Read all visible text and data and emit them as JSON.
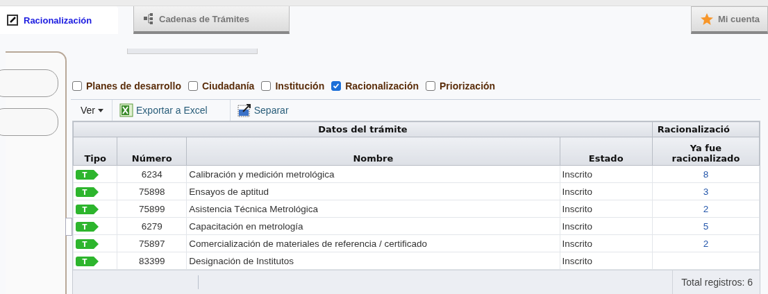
{
  "tabs": [
    {
      "label": "Racionalización",
      "selected": true
    },
    {
      "label": "Cadenas de Trámites",
      "selected": false
    }
  ],
  "account_tab": {
    "label": "Mi cuenta"
  },
  "filters": [
    {
      "label": "Planes de desarrollo",
      "checked": false
    },
    {
      "label": "Ciudadanía",
      "checked": false
    },
    {
      "label": "Institución",
      "checked": false
    },
    {
      "label": "Racionalización",
      "checked": true
    },
    {
      "label": "Priorización",
      "checked": false
    }
  ],
  "toolbar": [
    {
      "kind": "menu",
      "label": "Ver"
    },
    {
      "kind": "excel",
      "label": "Exportar a Excel"
    },
    {
      "kind": "split",
      "label": "Separar"
    }
  ],
  "table": {
    "groups": [
      {
        "label": "Datos del trámite"
      },
      {
        "label": "Racionalizació"
      }
    ],
    "columns": [
      "Tipo",
      "Número",
      "Nombre",
      "Estado",
      "Ya fue racionalizado"
    ],
    "rows": [
      {
        "tipo": "T",
        "numero": "6234",
        "nombre": "Calibración y medición metrológica",
        "estado": "Inscrito",
        "racionalizado": "8"
      },
      {
        "tipo": "T",
        "numero": "75898",
        "nombre": "Ensayos de aptitud",
        "estado": "Inscrito",
        "racionalizado": "3"
      },
      {
        "tipo": "T",
        "numero": "75899",
        "nombre": "Asistencia Técnica Metrológica",
        "estado": "Inscrito",
        "racionalizado": "2"
      },
      {
        "tipo": "T",
        "numero": "6279",
        "nombre": "Capacitación en metrología",
        "estado": "Inscrito",
        "racionalizado": "5"
      },
      {
        "tipo": "T",
        "numero": "75897",
        "nombre": "Comercialización de materiales de referencia / certificado",
        "estado": "Inscrito",
        "racionalizado": "2"
      },
      {
        "tipo": "T",
        "numero": "83399",
        "nombre": "Designación de Institutos",
        "estado": "Inscrito"
      }
    ]
  },
  "status_bar": {
    "total": "Total registros: 6"
  }
}
